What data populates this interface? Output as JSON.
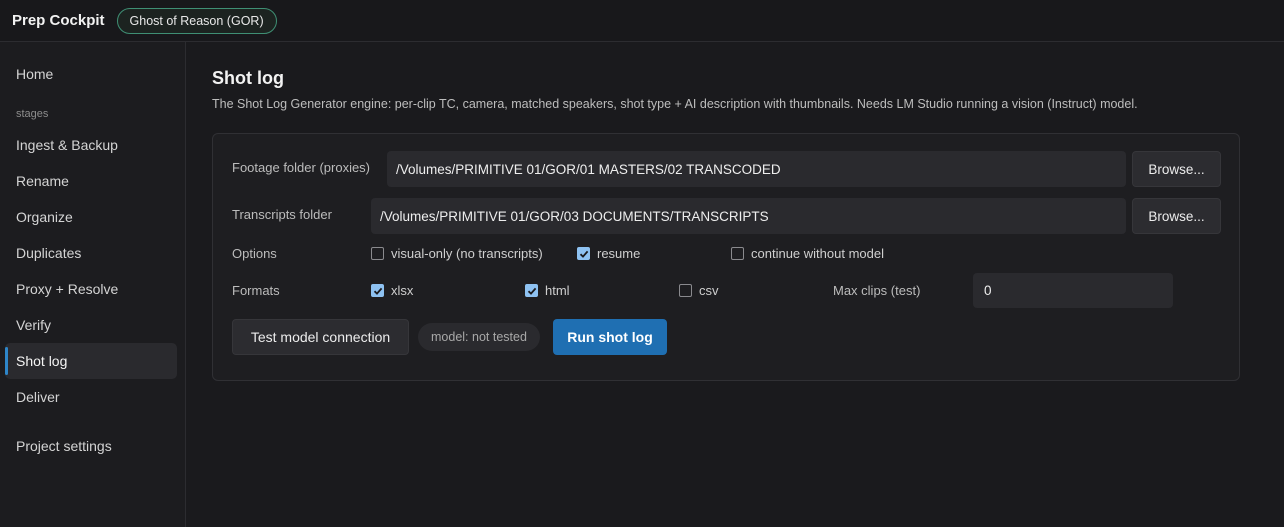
{
  "app": {
    "title": "Prep Cockpit",
    "project_badge": "Ghost of Reason (GOR)"
  },
  "sidebar": {
    "home": "Home",
    "section_label": "stages",
    "stages": [
      {
        "label": "Ingest & Backup",
        "active": false
      },
      {
        "label": "Rename",
        "active": false
      },
      {
        "label": "Organize",
        "active": false
      },
      {
        "label": "Duplicates",
        "active": false
      },
      {
        "label": "Proxy + Resolve",
        "active": false
      },
      {
        "label": "Verify",
        "active": false
      },
      {
        "label": "Shot log",
        "active": true
      },
      {
        "label": "Deliver",
        "active": false
      }
    ],
    "project_settings": "Project settings"
  },
  "page": {
    "title": "Shot log",
    "description": "The Shot Log Generator engine: per-clip TC, camera, matched speakers, shot type + AI description with thumbnails. Needs LM Studio running a vision (Instruct) model."
  },
  "form": {
    "footage": {
      "label": "Footage folder (proxies)",
      "value": "/Volumes/PRIMITIVE 01/GOR/01 MASTERS/02 TRANSCODED",
      "browse": "Browse..."
    },
    "transcripts": {
      "label": "Transcripts folder",
      "value": "/Volumes/PRIMITIVE 01/GOR/03 DOCUMENTS/TRANSCRIPTS",
      "browse": "Browse..."
    },
    "options": {
      "label": "Options",
      "visual_only": {
        "label": "visual-only (no transcripts)",
        "checked": false
      },
      "resume": {
        "label": "resume",
        "checked": true
      },
      "continue_without_model": {
        "label": "continue without model",
        "checked": false
      }
    },
    "formats": {
      "label": "Formats",
      "xlsx": {
        "label": "xlsx",
        "checked": true
      },
      "html": {
        "label": "html",
        "checked": true
      },
      "csv": {
        "label": "csv",
        "checked": false
      }
    },
    "max_clips": {
      "label": "Max clips (test)",
      "value": "0"
    },
    "actions": {
      "test_model": "Test model connection",
      "model_status": "model: not tested",
      "run": "Run shot log"
    }
  },
  "colors": {
    "accent": "#1f6fb2",
    "badge_border": "#3f8f74",
    "checkbox_on": "#8ec2f2"
  }
}
